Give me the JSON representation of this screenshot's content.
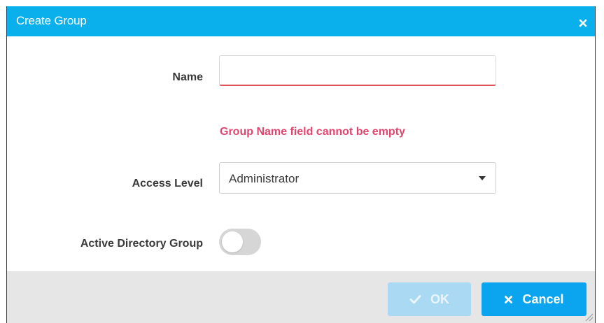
{
  "dialog": {
    "title": "Create Group",
    "close_icon": "close-icon"
  },
  "form": {
    "name_label": "Name",
    "name_value": "",
    "name_placeholder": "",
    "name_error": "Group Name field cannot be empty",
    "access_level_label": "Access Level",
    "access_level_value": "Administrator",
    "active_directory_label": "Active Directory Group",
    "active_directory_enabled": false
  },
  "footer": {
    "ok_label": "OK",
    "ok_enabled": false,
    "ok_icon": "check-icon",
    "cancel_label": "Cancel",
    "cancel_icon": "close-icon"
  },
  "colors": {
    "header": "#0ab0ec",
    "error": "#e4446e",
    "primary_button": "#0aa5ee",
    "disabled_button": "#a9d9f3",
    "footer_bg": "#e6e6e6"
  }
}
